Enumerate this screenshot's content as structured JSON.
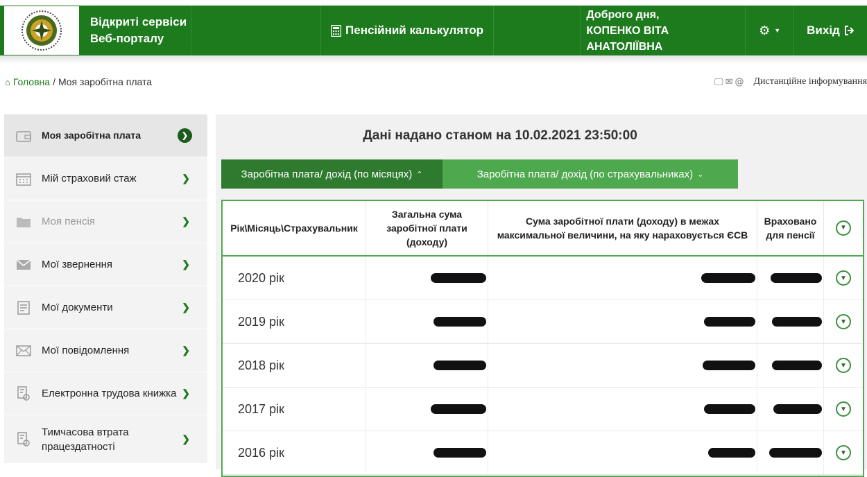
{
  "header": {
    "brand_line1": "Відкриті сервіси",
    "brand_line2": "Веб-порталу",
    "calculator": "Пенсійний калькулятор",
    "greeting": "Доброго дня,",
    "user_name": "КОПЕНКО ВІТА АНАТОЛІЇВНА",
    "logout": "Вихід",
    "accent_color": "#1d7a1d"
  },
  "breadcrumb": {
    "home": "Головна",
    "separator": "/",
    "current": "Моя заробітна плата"
  },
  "remote_info": {
    "label": "Дистанційне інформування"
  },
  "sidebar": {
    "items": [
      {
        "label": "Моя заробітна плата",
        "icon": "wallet-icon"
      },
      {
        "label": "Мій страховий стаж",
        "icon": "calendar-icon"
      },
      {
        "label": "Моя пенсія",
        "icon": "folder-icon"
      },
      {
        "label": "Мої звернення",
        "icon": "envelope-icon"
      },
      {
        "label": "Мої документи",
        "icon": "document-icon"
      },
      {
        "label": "Мої повідомлення",
        "icon": "mail-icon"
      },
      {
        "label": "Електронна трудова книжка",
        "icon": "workbook-icon"
      },
      {
        "label": "Тимчасова втрата працездатності",
        "icon": "sick-leave-icon"
      }
    ]
  },
  "main": {
    "as_of": "Дані надано станом на 10.02.2021 23:50:00",
    "tabs": [
      {
        "label": "Заробітна плата/ дохід (по місяцях)",
        "chevron": "up"
      },
      {
        "label": "Заробітна плата/ дохід (по страхувальниках)",
        "chevron": "down"
      }
    ],
    "table": {
      "headers": [
        "Рік\\Місяць\\Страхувальник",
        "Загальна сума заробітної плати (доходу)",
        "Сума заробітної плати (доходу) в межах максимальної величини, на яку нараховується ЄСВ",
        "Враховано для пенсії"
      ],
      "rows": [
        {
          "year": "2020 рік"
        },
        {
          "year": "2019 рік"
        },
        {
          "year": "2018 рік"
        },
        {
          "year": "2017 рік"
        },
        {
          "year": "2016 рік"
        }
      ]
    }
  }
}
